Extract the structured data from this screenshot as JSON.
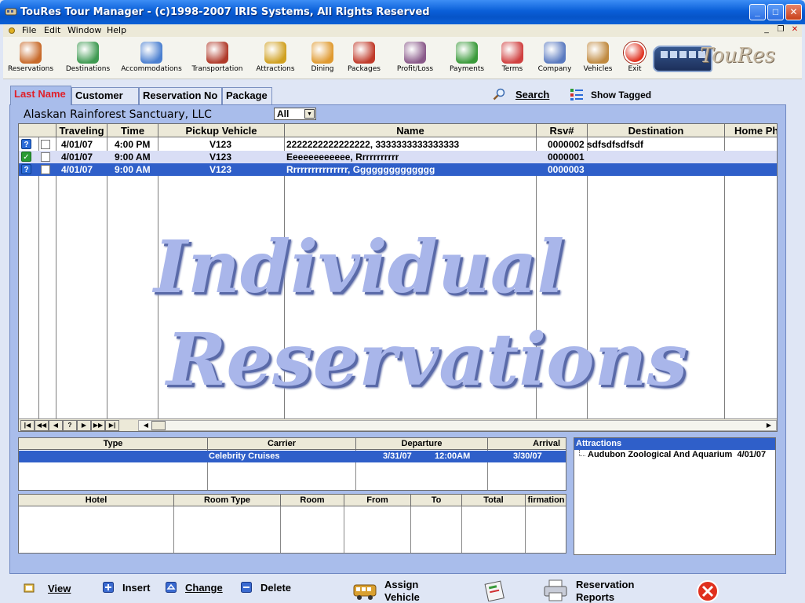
{
  "window": {
    "title": "TouRes Tour Manager - (c)1998-2007 IRIS Systems, All Rights Reserved",
    "min_glyph": "_",
    "max_glyph": "□",
    "close_glyph": "✕"
  },
  "menu": {
    "items": [
      "File",
      "Edit",
      "Window",
      "Help"
    ],
    "mdi_min": "_",
    "mdi_restore": "❐",
    "mdi_close": "✕"
  },
  "toolbar": {
    "buttons": [
      {
        "label": "Reservations",
        "icon": "person-icon",
        "color": "#c86a2a"
      },
      {
        "label": "Destinations",
        "icon": "globe-icon",
        "color": "#3f9a52"
      },
      {
        "label": "Accommodations",
        "icon": "bed-icon",
        "color": "#4a7fd0"
      },
      {
        "label": "Transportation",
        "icon": "bus-icon",
        "color": "#b03a2a"
      },
      {
        "label": "Attractions",
        "icon": "flag-icon",
        "color": "#d0a020"
      },
      {
        "label": "Dining",
        "icon": "plate-icon",
        "color": "#e09a30"
      },
      {
        "label": "Packages",
        "icon": "gift-icon",
        "color": "#c03a2a"
      },
      {
        "label": "Profit/Loss",
        "icon": "scales-icon",
        "color": "#8a5a8a"
      },
      {
        "label": "Payments",
        "icon": "payment-icon",
        "color": "#3a9a3a"
      },
      {
        "label": "Terms",
        "icon": "ribbon-icon",
        "color": "#d04040"
      },
      {
        "label": "Company",
        "icon": "building-icon",
        "color": "#5a7ac0"
      },
      {
        "label": "Vehicles",
        "icon": "people-icon",
        "color": "#c08a40"
      },
      {
        "label": "Exit",
        "icon": "exit-icon",
        "color": "#e0301e"
      }
    ],
    "logo_text": "TouRes"
  },
  "tabs": [
    {
      "label": "Last Name",
      "active": true
    },
    {
      "label": "Customer ID",
      "active": false
    },
    {
      "label": "Reservation No",
      "active": false
    },
    {
      "label": "Package",
      "active": false
    }
  ],
  "search_label": "Search",
  "show_tagged_label": "Show Tagged",
  "company_name": "Alaskan Rainforest Sanctuary, LLC",
  "filter": {
    "value": "All",
    "arrow": "▼"
  },
  "grid": {
    "columns": [
      "Traveling",
      "Time",
      "Pickup Vehicle",
      "Name",
      "Rsv#",
      "Destination",
      "Home Ph"
    ],
    "rows": [
      {
        "status": "?",
        "traveling": "4/01/07",
        "time": "4:00 PM",
        "vehicle": "V123",
        "name": "2222222222222222, 3333333333333333",
        "rsv": "0000002",
        "destination": "sdfsdfsdfsdf",
        "home_ph": ""
      },
      {
        "status": "✓",
        "traveling": "4/01/07",
        "time": "9:00 AM",
        "vehicle": "V123",
        "name": "Eeeeeeeeeeee, Rrrrrrrrrrr",
        "rsv": "0000001",
        "destination": "",
        "home_ph": ""
      },
      {
        "status": "?",
        "traveling": "4/01/07",
        "time": "9:00 AM",
        "vehicle": "V123",
        "name": "Rrrrrrrrrrrrrrrr, Gggggggggggggg",
        "rsv": "0000003",
        "destination": "",
        "home_ph": ""
      }
    ],
    "nav_buttons": [
      "|◀",
      "◀◀",
      "◀",
      "?",
      "▶",
      "▶▶",
      "▶|"
    ],
    "scroll_left": "◀",
    "scroll_right": "▶"
  },
  "watermark": {
    "line1": "Individual",
    "line2": "Reservations"
  },
  "transport": {
    "columns": [
      "Type",
      "Carrier",
      "Departure",
      "Arrival"
    ],
    "row": {
      "type": "",
      "carrier": "Celebrity Cruises",
      "dep_date": "3/31/07",
      "dep_time": "12:00AM",
      "arr_date": "3/30/07"
    }
  },
  "hotel": {
    "columns": [
      "Hotel",
      "Room Type",
      "Room",
      "From",
      "To",
      "Total",
      "firmation"
    ]
  },
  "attractions": {
    "header": "Attractions",
    "items": [
      {
        "name": "Audubon Zoological And Aquarium",
        "date": "4/01/07"
      }
    ]
  },
  "actions": {
    "view": "View",
    "insert": "Insert",
    "change": "Change",
    "delete": "Delete",
    "assign_line1": "Assign",
    "assign_line2": "Vehicle",
    "reports_line1": "Reservation",
    "reports_line2": "Reports"
  }
}
